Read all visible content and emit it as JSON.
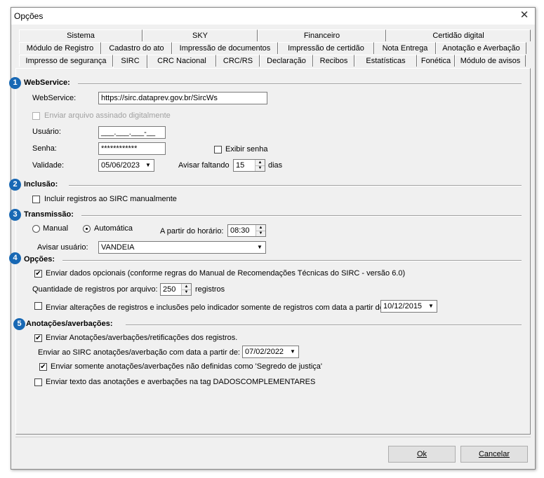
{
  "window": {
    "title": "Opções"
  },
  "tabs": {
    "row1": [
      "Sistema",
      "SKY",
      "Financeiro",
      "Certidão digital"
    ],
    "row2": [
      "Módulo de Registro",
      "Cadastro do ato",
      "Impressão de documentos",
      "Impressão de certidão",
      "Nota Entrega",
      "Anotação e Averbação"
    ],
    "row3": [
      "Impresso de segurança",
      "SIRC",
      "CRC Nacional",
      "CRC/RS",
      "Declaração",
      "Recibos",
      "Estatísticas",
      "Fonética",
      "Módulo de avisos"
    ],
    "active": "SIRC"
  },
  "badges": [
    "1",
    "2",
    "3",
    "4",
    "5"
  ],
  "webservice": {
    "group_title": "WebService:",
    "url_label": "WebService:",
    "url_value": "https://sirc.dataprev.gov.br/SircWs",
    "signed_label": "Enviar arquivo assinado digitalmente",
    "user_label": "Usuário:",
    "user_value": "___.___.___-__",
    "password_label": "Senha:",
    "password_value": "************",
    "show_password_label": "Exibir senha",
    "validity_label": "Validade:",
    "validity_value": "05/06/2023",
    "warn_label": "Avisar faltando",
    "warn_value": "15",
    "warn_unit": "dias"
  },
  "inclusao": {
    "group_title": "Inclusão:",
    "manual_label": "Incluir registros ao SIRC manualmente"
  },
  "transmissao": {
    "group_title": "Transmissão:",
    "manual_label": "Manual",
    "auto_label": "Automática",
    "selected": "Automática",
    "time_label": "A partir do horário:",
    "time_value": "08:30",
    "notify_label": "Avisar usuário:",
    "notify_value": "VANDEIA"
  },
  "opcoes": {
    "group_title": "Opções:",
    "optional_label": "Enviar dados opcionais (conforme regras do Manual de Recomendações Técnicas do SIRC - versão 6.0)",
    "qty_label": "Quantidade de registros por arquivo:",
    "qty_value": "250",
    "qty_unit": "registros",
    "changes_label": "Enviar alterações de registros e inclusões pelo indicador somente de registros com data a partir de:",
    "changes_date": "10/12/2015"
  },
  "anotacoes": {
    "group_title": "Anotações/averbações:",
    "send_label": "Enviar Anotações/averbações/retificações dos registros.",
    "date_label": "Enviar ao SIRC anotações/averbação com data a partir de:",
    "date_value": "07/02/2022",
    "secret_label": "Enviar somente anotações/averbações não definidas como 'Segredo de justiça'",
    "tag_label": "Enviar texto das anotações e averbações na tag DADOSCOMPLEMENTARES"
  },
  "buttons": {
    "ok": "Ok",
    "cancel": "Cancelar"
  },
  "icons": {
    "check": "✔",
    "dropdown": "▼",
    "spin_up": "▲",
    "spin_down": "▼",
    "close": "✕"
  },
  "colors": {
    "badge": "#1868b4",
    "window_bg": "#f0f0f0"
  }
}
